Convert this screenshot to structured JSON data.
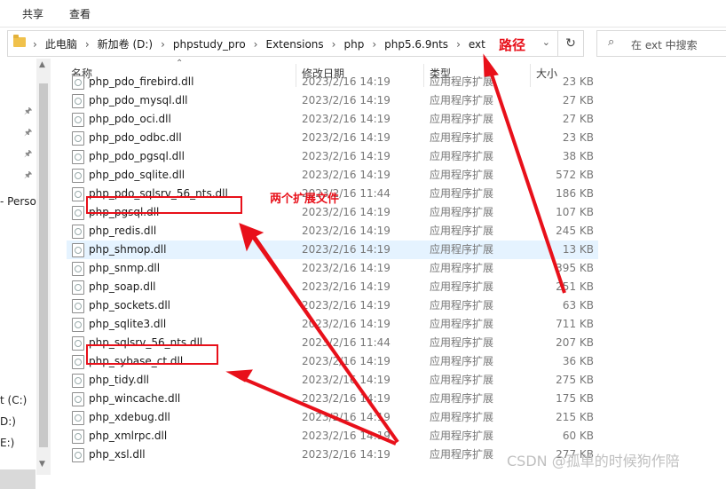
{
  "ribbon": {
    "tabs": [
      "共享",
      "查看"
    ]
  },
  "address": {
    "crumbs": [
      "此电脑",
      "新加卷 (D:)",
      "phpstudy_pro",
      "Extensions",
      "php",
      "php5.6.9nts",
      "ext"
    ],
    "annotation": "路径"
  },
  "search": {
    "placeholder": "在 ext 中搜索"
  },
  "nav": {
    "partial_labels": [
      "- Perso",
      "t (C:)",
      "D:)",
      "E:)"
    ]
  },
  "columns": {
    "name": "名称",
    "date": "修改日期",
    "type": "类型",
    "size": "大小"
  },
  "files": [
    {
      "name": "php_pdo_firebird.dll",
      "date": "2023/2/16 14:19",
      "type": "应用程序扩展",
      "size": "23 KB"
    },
    {
      "name": "php_pdo_mysql.dll",
      "date": "2023/2/16 14:19",
      "type": "应用程序扩展",
      "size": "27 KB"
    },
    {
      "name": "php_pdo_oci.dll",
      "date": "2023/2/16 14:19",
      "type": "应用程序扩展",
      "size": "27 KB"
    },
    {
      "name": "php_pdo_odbc.dll",
      "date": "2023/2/16 14:19",
      "type": "应用程序扩展",
      "size": "23 KB"
    },
    {
      "name": "php_pdo_pgsql.dll",
      "date": "2023/2/16 14:19",
      "type": "应用程序扩展",
      "size": "38 KB"
    },
    {
      "name": "php_pdo_sqlite.dll",
      "date": "2023/2/16 14:19",
      "type": "应用程序扩展",
      "size": "572 KB"
    },
    {
      "name": "php_pdo_sqlsrv_56_nts.dll",
      "date": "2023/2/16 11:44",
      "type": "应用程序扩展",
      "size": "186 KB"
    },
    {
      "name": "php_pgsql.dll",
      "date": "2023/2/16 14:19",
      "type": "应用程序扩展",
      "size": "107 KB"
    },
    {
      "name": "php_redis.dll",
      "date": "2023/2/16 14:19",
      "type": "应用程序扩展",
      "size": "245 KB"
    },
    {
      "name": "php_shmop.dll",
      "date": "2023/2/16 14:19",
      "type": "应用程序扩展",
      "size": "13 KB"
    },
    {
      "name": "php_snmp.dll",
      "date": "2023/2/16 14:19",
      "type": "应用程序扩展",
      "size": "395 KB"
    },
    {
      "name": "php_soap.dll",
      "date": "2023/2/16 14:19",
      "type": "应用程序扩展",
      "size": "251 KB"
    },
    {
      "name": "php_sockets.dll",
      "date": "2023/2/16 14:19",
      "type": "应用程序扩展",
      "size": "63 KB"
    },
    {
      "name": "php_sqlite3.dll",
      "date": "2023/2/16 14:19",
      "type": "应用程序扩展",
      "size": "711 KB"
    },
    {
      "name": "php_sqlsrv_56_nts.dll",
      "date": "2023/2/16 11:44",
      "type": "应用程序扩展",
      "size": "207 KB"
    },
    {
      "name": "php_sybase_ct.dll",
      "date": "2023/2/16 14:19",
      "type": "应用程序扩展",
      "size": "36 KB"
    },
    {
      "name": "php_tidy.dll",
      "date": "2023/2/16 14:19",
      "type": "应用程序扩展",
      "size": "275 KB"
    },
    {
      "name": "php_wincache.dll",
      "date": "2023/2/16 14:19",
      "type": "应用程序扩展",
      "size": "175 KB"
    },
    {
      "name": "php_xdebug.dll",
      "date": "2023/2/16 14:19",
      "type": "应用程序扩展",
      "size": "215 KB"
    },
    {
      "name": "php_xmlrpc.dll",
      "date": "2023/2/16 14:19",
      "type": "应用程序扩展",
      "size": "60 KB"
    },
    {
      "name": "php_xsl.dll",
      "date": "2023/2/16 14:19",
      "type": "应用程序扩展",
      "size": "277 KB"
    }
  ],
  "highlighted_file": "php_shmop.dll",
  "annotations": {
    "two_files": "两个扩展文件",
    "accent_color": "#e8101a"
  },
  "watermark": "CSDN @孤单的时候狗作陪"
}
